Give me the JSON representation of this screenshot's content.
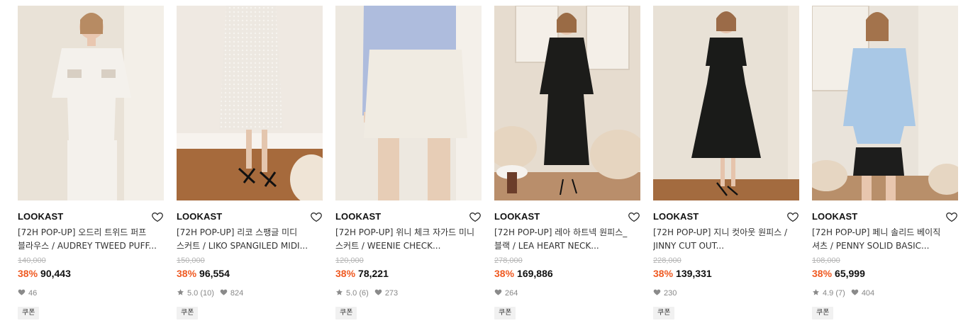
{
  "products": [
    {
      "brand": "LOOKAST",
      "title_line1": "[72H POP-UP] 오드리 트위드 퍼프",
      "title_line2": "블라우스 / AUDREY TWEED PUFF...",
      "original_price": "140,000",
      "discount": "38%",
      "price": "90,443",
      "rating": "",
      "reviews": "",
      "likes": "46",
      "coupon": "쿠폰",
      "image_icon": "model-white-tweed-blouse",
      "palette": {
        "bg": "#e9e2d7",
        "garment": "#f4f1ec",
        "accent": "#d8cfc3"
      }
    },
    {
      "brand": "LOOKAST",
      "title_line1": "[72H POP-UP] 리코 스팽글 미디",
      "title_line2": "스커트 / LIKO SPANGILED MIDI...",
      "original_price": "150,000",
      "discount": "38%",
      "price": "96,554",
      "rating": "5.0",
      "reviews": "(10)",
      "likes": "824",
      "coupon": "쿠폰",
      "image_icon": "model-sequin-midi-skirt",
      "palette": {
        "bg": "#efe9e2",
        "garment": "#ede8e1",
        "accent": "#8a5a34"
      }
    },
    {
      "brand": "LOOKAST",
      "title_line1": "[72H POP-UP] 위니 체크 자가드 미니",
      "title_line2": "스커트 / WEENIE CHECK...",
      "original_price": "120,000",
      "discount": "38%",
      "price": "78,221",
      "rating": "5.0",
      "reviews": "(6)",
      "likes": "273",
      "coupon": "쿠폰",
      "image_icon": "model-white-mini-skirt",
      "palette": {
        "bg": "#ede8e0",
        "garment": "#f0ebe2",
        "accent": "#aebcdd"
      }
    },
    {
      "brand": "LOOKAST",
      "title_line1": "[72H POP-UP] 레아 하트넥 원피스_",
      "title_line2": "블랙 / LEA HEART NECK...",
      "original_price": "278,000",
      "discount": "38%",
      "price": "169,886",
      "rating": "",
      "reviews": "",
      "likes": "264",
      "coupon": "쿠폰",
      "image_icon": "model-black-dress",
      "palette": {
        "bg": "#e6dccf",
        "garment": "#1c1c1a",
        "accent": "#d9c8b3"
      }
    },
    {
      "brand": "LOOKAST",
      "title_line1": "[72H POP-UP] 지니 컷아웃 원피스 /",
      "title_line2": "JINNY CUT OUT...",
      "original_price": "228,000",
      "discount": "38%",
      "price": "139,331",
      "rating": "",
      "reviews": "",
      "likes": "230",
      "coupon": "쿠폰",
      "image_icon": "model-black-cutout-dress",
      "palette": {
        "bg": "#e8e1d6",
        "garment": "#1a1b19",
        "accent": "#a36b3f"
      }
    },
    {
      "brand": "LOOKAST",
      "title_line1": "[72H POP-UP] 페니 솔리드 베이직",
      "title_line2": "셔츠 / PENNY SOLID BASIC...",
      "original_price": "108,000",
      "discount": "38%",
      "price": "65,999",
      "rating": "4.9",
      "reviews": "(7)",
      "likes": "404",
      "coupon": "쿠폰",
      "image_icon": "model-blue-shirt",
      "palette": {
        "bg": "#e9e3da",
        "garment": "#a9c8e6",
        "accent": "#1d1d1c"
      }
    }
  ]
}
